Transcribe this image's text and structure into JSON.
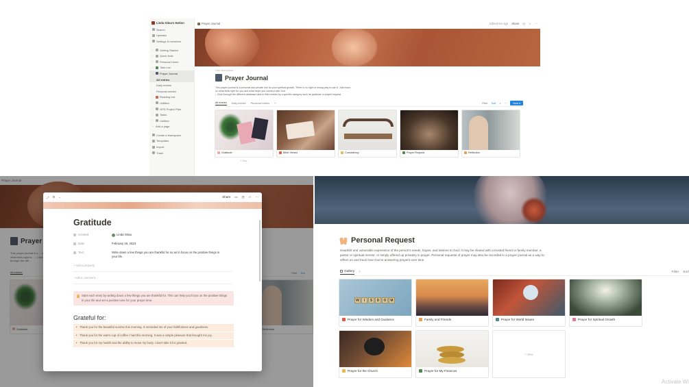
{
  "panel_a": {
    "sidebar": {
      "workspace": "Linda Gitau's Notion",
      "top_items": [
        "Search",
        "Updates",
        "Settings & members"
      ],
      "pages": [
        "Getting Started",
        "Quick Note",
        "Personal Home",
        "Task List",
        "Prayer Journal"
      ],
      "sub_items": [
        "All entries",
        "Daily entries",
        "Personal entries"
      ],
      "pages_after": [
        "Reading List",
        "Untitled",
        "OPS Project Plan",
        "Tasks",
        "Untitled"
      ],
      "add_page": "Add a page",
      "bottom_items": [
        "Create a teamspace",
        "Templates",
        "Import",
        "Trash"
      ]
    },
    "topbar": {
      "breadcrumb": "Prayer Journal",
      "edited": "Edited 6m ago",
      "share": "Share"
    },
    "hide_description": "Hide description",
    "title": "Prayer Journal",
    "description": [
      "This prayer journal is a personal and private tool for your spiritual growth. There is no right or wrong way to use it. Just focus",
      "on what feels right for you and what helps you connect with God.",
      "↓ Click through the different database tabs to filter entries by a specific category such as gratitude or prayer request."
    ],
    "tabs": [
      "All entries",
      "Daily entries",
      "Personal entries"
    ],
    "tools": {
      "filter": "Filter",
      "sort": "Sort",
      "new": "New"
    },
    "cards": [
      {
        "label": "Gratitude",
        "color": "#f0a8a0"
      },
      {
        "label": "Bible Verses",
        "color": "#e05b4a"
      },
      {
        "label": "Consistency",
        "color": "#e8b84c"
      },
      {
        "label": "Prayer Request",
        "color": "#4f8a4f"
      },
      {
        "label": "Reflection",
        "color": "#e8a04c"
      }
    ],
    "new_row": "+ New"
  },
  "panel_b": {
    "breadcrumb": "Prayer Journal",
    "title": "Prayer",
    "description": "This prayer journal is a ... on what feels right fo... ↓ Click through the diff...",
    "tab": "All entries",
    "tools": {
      "filter": "Filter",
      "sort": "Sor"
    },
    "cards": [
      {
        "label": "Gratitude",
        "color": "#f0a8a0"
      },
      {
        "label": "",
        "color": "#e05b4a"
      },
      {
        "label": "",
        "color": "#e8b84c"
      },
      {
        "label": "",
        "color": "#4f8a4f"
      },
      {
        "label": "Reflection",
        "color": "#e8a04c"
      }
    ],
    "modal": {
      "share": "Share",
      "title": "Gratitude",
      "props": [
        {
          "key": "Created",
          "value": "Linda Gitau",
          "type": "person"
        },
        {
          "key": "Date",
          "value": "February 26, 2023",
          "type": "text"
        },
        {
          "key": "Text",
          "value": "Write down a few things you are thankful for so as to focus on the positive things in your life.",
          "type": "text"
        }
      ],
      "add_property": "+ Add a property",
      "add_comment": "Add a comment...",
      "callout": "Start each entry by writing down a few things you are thankful for. This can help you focus on the positive things in your life and set a positive tone for your prayer time.",
      "heading": "Grateful for:",
      "list": [
        "Thank you for the beautiful sunrise this morning. It reminded me of your faithfulness and goodness.",
        "Thank you for the warm cup of coffee I had this morning. It was a simple pleasure that brought me joy.",
        "Thank you for my health and the ability to move my body. I don't take it for granted."
      ]
    }
  },
  "panel_c": {
    "title": "Personal Request",
    "description": "Heartfelt and vulnerable expression of the person's needs, hopes, and desires to God. It may be shared with a trusted friend or family member, a pastor or spiritual mentor, or simply offered up privately in prayer. Personal requests of prayer may also be recorded in a prayer journal as a way to reflect on and track how God is answering prayers over time.",
    "tab": "Gallery",
    "tools": {
      "filter": "Filter",
      "sort": "Sort"
    },
    "cards": [
      {
        "label": "Prayer for Wisdom and Guidance",
        "color": "#e05b4a"
      },
      {
        "label": "Family and Friends",
        "color": "#e8a04c"
      },
      {
        "label": "Prayer for World Issues",
        "color": "#4f8a8a"
      },
      {
        "label": "Prayer for Spiritual Growth",
        "color": "#d97aa0"
      },
      {
        "label": "Prayer for the Church",
        "color": "#e8b84c"
      },
      {
        "label": "Prayer for My Finances",
        "color": "#4f8a4f"
      }
    ],
    "new_card": "+ New",
    "wisdom_letters": [
      "W",
      "I",
      "S",
      "D",
      "O",
      "M"
    ],
    "watermark": "Activate Wi"
  }
}
